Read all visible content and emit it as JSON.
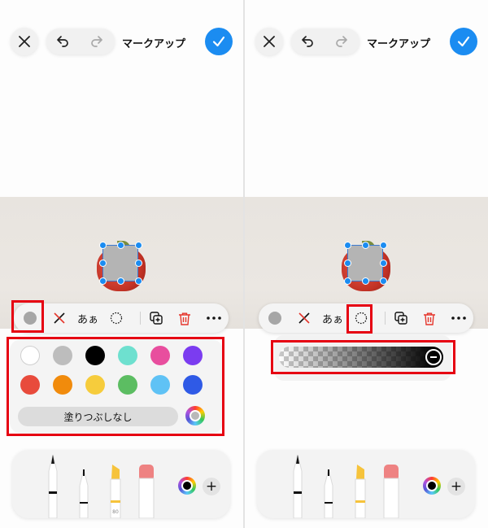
{
  "header": {
    "title": "マークアップ"
  },
  "toolbar": {
    "text_style_label": "あぁ"
  },
  "fill_panel": {
    "no_fill_label": "塗りつぶしなし",
    "colors": [
      "#ffffff",
      "#bdbdbd",
      "#000000",
      "#6ee0cf",
      "#e84e9e",
      "#7b3cf0",
      "#e84b3c",
      "#f18b0c",
      "#f6cc3c",
      "#5cbd62",
      "#5fc2f5",
      "#2f5ae6"
    ]
  },
  "tray": {
    "marker_tip_label": "80"
  },
  "colors": {
    "accent": "#1b8cf1",
    "highlight": "#e60012",
    "delete": "#e5352b"
  }
}
